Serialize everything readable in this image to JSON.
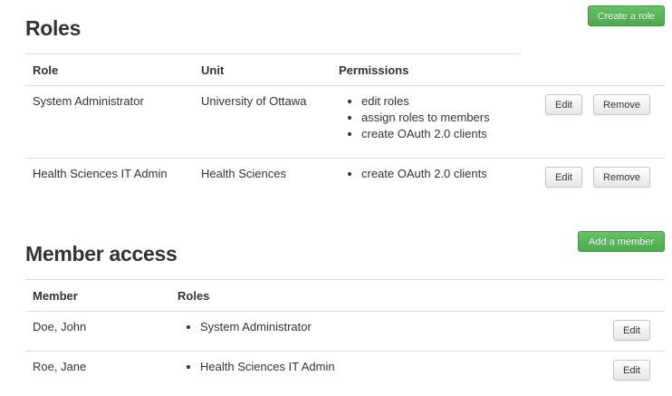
{
  "roles_section": {
    "title": "Roles",
    "create_button": "Create a role",
    "headers": {
      "role": "Role",
      "unit": "Unit",
      "permissions": "Permissions"
    },
    "rows": [
      {
        "role": "System Administrator",
        "unit": "University of Ottawa",
        "permissions": [
          "edit roles",
          "assign roles to members",
          "create OAuth 2.0 clients"
        ],
        "edit_label": "Edit",
        "remove_label": "Remove"
      },
      {
        "role": "Health Sciences IT Admin",
        "unit": "Health Sciences",
        "permissions": [
          "create OAuth 2.0 clients"
        ],
        "edit_label": "Edit",
        "remove_label": "Remove"
      }
    ]
  },
  "members_section": {
    "title": "Member access",
    "add_button": "Add a member",
    "headers": {
      "member": "Member",
      "roles": "Roles"
    },
    "rows": [
      {
        "member": "Doe, John",
        "roles": [
          "System Administrator"
        ],
        "edit_label": "Edit"
      },
      {
        "member": "Roe, Jane",
        "roles": [
          "Health Sciences IT Admin"
        ],
        "edit_label": "Edit"
      }
    ]
  },
  "colors": {
    "green_button": "#5bb75b",
    "border": "#dddddd",
    "text": "#333333"
  }
}
